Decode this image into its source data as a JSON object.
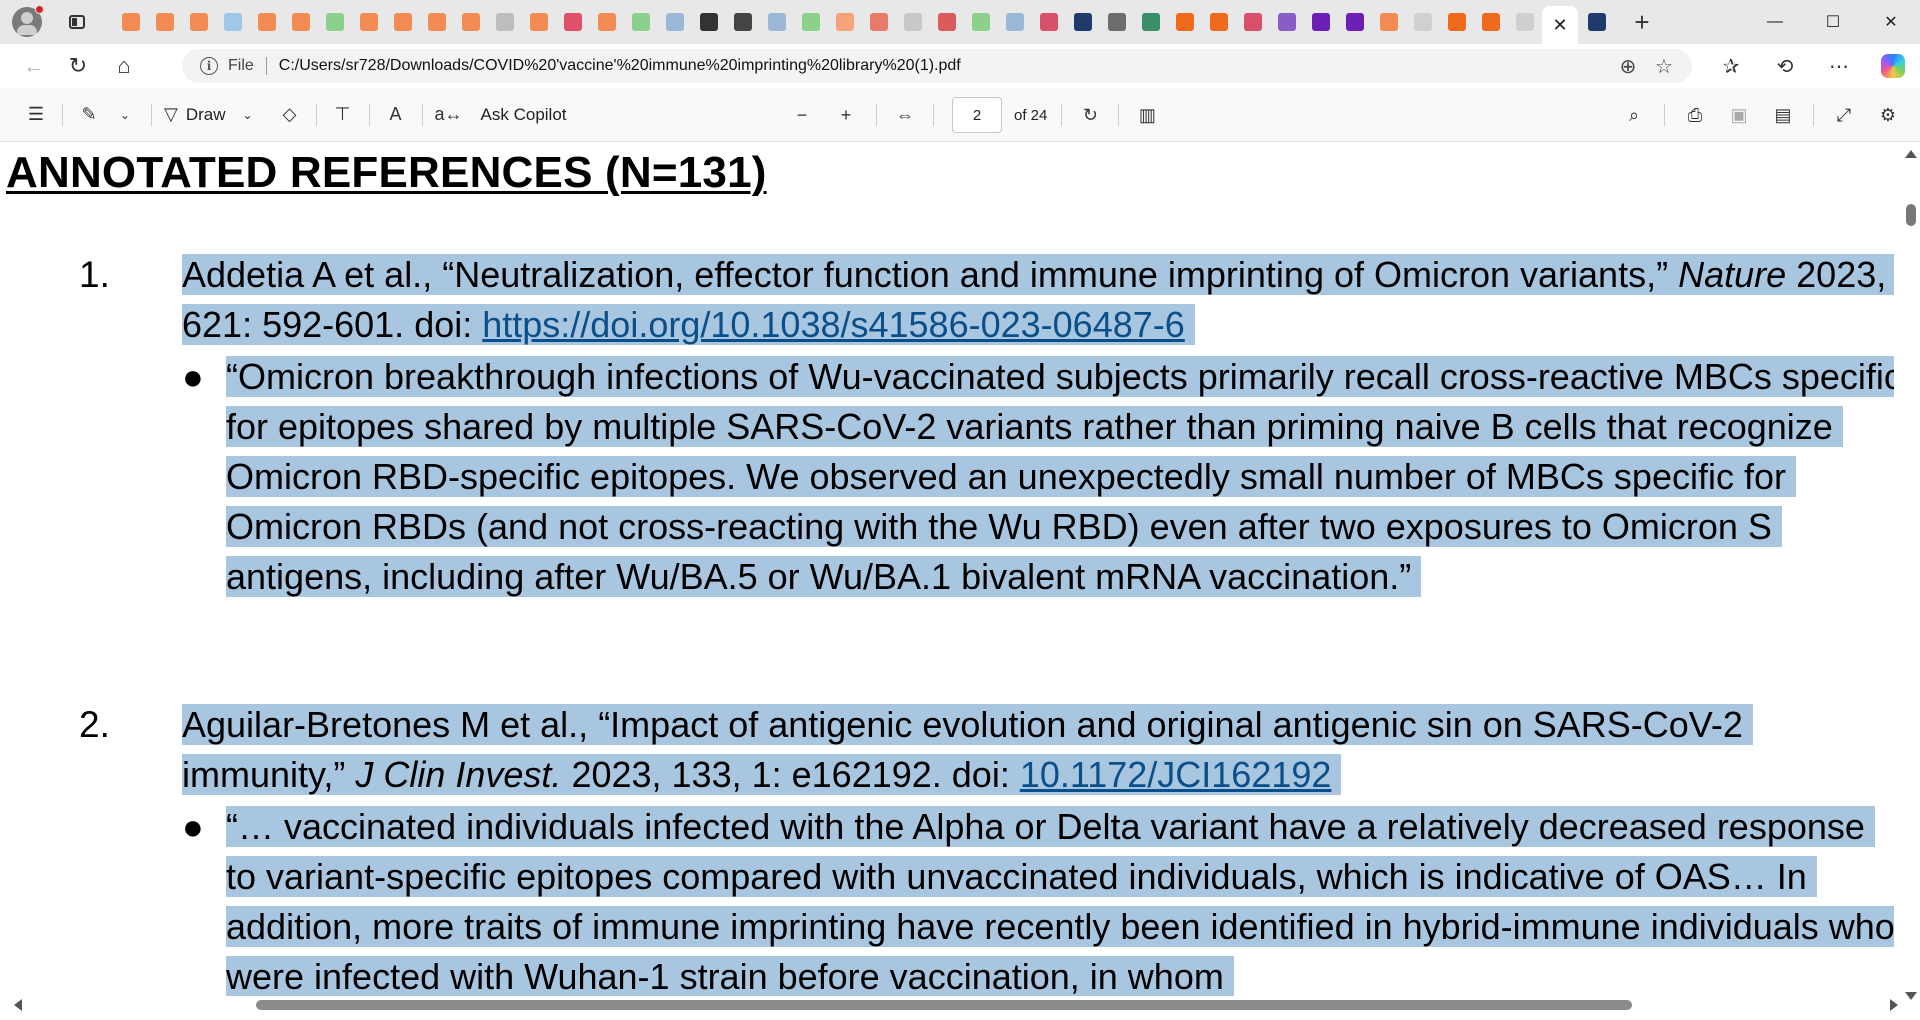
{
  "browser": {
    "tab_close_label": "✕",
    "new_tab_label": "+",
    "favicon_colors": [
      "#f28b54",
      "#f28b54",
      "#f28b54",
      "#9ec7e8",
      "#f28b54",
      "#f28b54",
      "#8bd08b",
      "#f28b54",
      "#f28b54",
      "#f28b54",
      "#f28b54",
      "#bdbdbd",
      "#f28b54",
      "#e0506a",
      "#f28b54",
      "#8bd08b",
      "#9bb8d8",
      "#333333",
      "#444444",
      "#9bb8d8",
      "#8bd08b",
      "#f5a37a",
      "#e87a6a",
      "#c8c8c8",
      "#d95b5b",
      "#8bd08b",
      "#9bb8d8",
      "#d9506a",
      "#1f3a6b",
      "#6d6d6d",
      "#3a8f6b",
      "#f06a1e",
      "#f06a1e",
      "#d9506a",
      "#8a5cc6",
      "#6b1fb5",
      "#6b1fb5",
      "#f28b54",
      "#d0d0d0",
      "#f06a1e",
      "#f06a1e",
      "#cfcfcf"
    ],
    "window_controls": {
      "minimize": "—",
      "maximize": "☐",
      "close": "✕"
    }
  },
  "address_bar": {
    "scheme_label": "File",
    "url": "C:/Users/sr728/Downloads/COVID%20'vaccine'%20immune%20imprinting%20library%20(1).pdf"
  },
  "pdf_toolbar": {
    "draw_label": "Draw",
    "ask_copilot_label": "Ask Copilot",
    "current_page": "2",
    "total_pages": "of 24"
  },
  "document": {
    "title": "ANNOTATED REFERENCES (N=131)",
    "references": [
      {
        "number": "1.",
        "authors": "Addetia A et al., ",
        "article_title": "“Neutralization, effector function and immune imprinting of Omicron variants,”",
        "journal": "Nature",
        "details": " 2023, 621: 592-601. doi: ",
        "doi_link": "https://doi.org/10.1038/s41586-023-06487-6",
        "bullet_mark": "●",
        "quote": "“Omicron breakthrough infections of Wu-vaccinated subjects primarily recall cross-reactive MBCs specific for epitopes shared by multiple SARS-CoV-2 variants rather than priming naive B cells that recognize Omicron RBD-specific epitopes. We observed an unexpectedly small number of MBCs specific for Omicron RBDs (and not cross-reacting with the Wu RBD) even after two exposures to Omicron S antigens, including after Wu/BA.5 or Wu/BA.1 bivalent mRNA vaccination.”"
      },
      {
        "number": "2.",
        "authors": "Aguilar-Bretones M et al., ",
        "article_title": "“Impact of antigenic evolution and original antigenic sin on SARS-CoV-2 immunity,”",
        "journal": "J Clin Invest.",
        "details": " 2023, 133, 1: e162192. doi: ",
        "doi_link": "10.1172/JCI162192",
        "bullet_mark": "●",
        "quote": "“… vaccinated individuals infected with the Alpha or Delta variant have a relatively decreased response to variant-specific epitopes compared with unvaccinated individuals, which is indicative of OAS… In addition, more traits of immune imprinting have recently been identified in hybrid-immune individuals who were infected with Wuhan-1 strain before vaccination, in whom"
      }
    ]
  }
}
